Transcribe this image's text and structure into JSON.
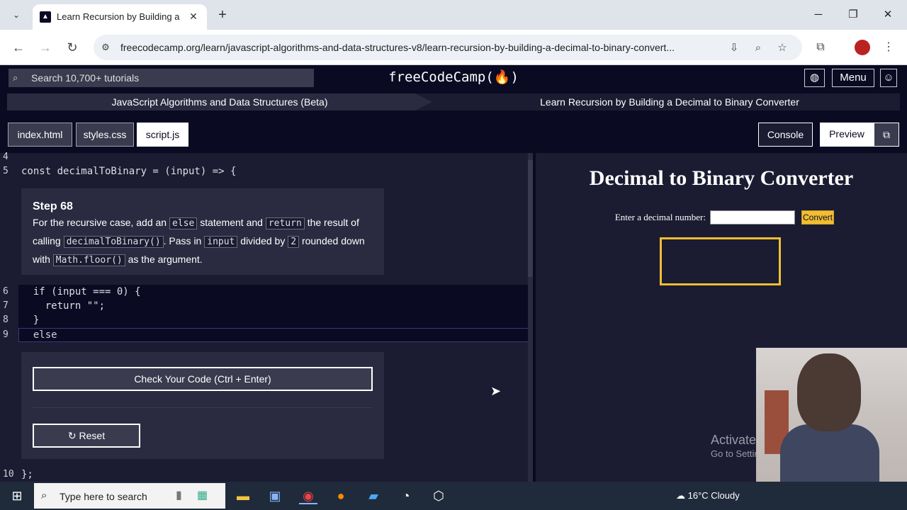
{
  "browser": {
    "tab_title": "Learn Recursion by Building a Decimal to Binary Converter",
    "url": "freecodecamp.org/learn/javascript-algorithms-and-data-structures-v8/learn-recursion-by-building-a-decimal-to-binary-convert..."
  },
  "fcc": {
    "search_placeholder": "Search 10,700+ tutorials",
    "logo": "freeCodeCamp(🔥)",
    "menu_label": "Menu"
  },
  "breadcrumb": {
    "course": "JavaScript Algorithms and Data Structures (Beta)",
    "project": "Learn Recursion by Building a Decimal to Binary Converter"
  },
  "file_tabs": [
    "index.html",
    "styles.css",
    "script.js"
  ],
  "right_tabs": {
    "console": "Console",
    "preview": "Preview"
  },
  "editor": {
    "line4_num": "4",
    "line5_num": "5",
    "line5_code": "const decimalToBinary = (input) => {",
    "lines": [
      {
        "num": "6",
        "code": "  if (input === 0) {"
      },
      {
        "num": "7",
        "code": "    return \"\";"
      },
      {
        "num": "8",
        "code": "  }"
      },
      {
        "num": "9",
        "code": "  else"
      }
    ],
    "line10_num": "10",
    "line10_code": "};"
  },
  "step": {
    "title": "Step 68",
    "t1": "For the recursive case, add an",
    "c1": "else",
    "t2": "statement and",
    "c2": "return",
    "t3": "the result of calling",
    "c3": "decimalToBinary()",
    "t4": ". Pass in",
    "c4": "input",
    "t5": "divided by",
    "c5": "2",
    "t6": "rounded down with",
    "c6": "Math.floor()",
    "t7": "as the argument."
  },
  "actions": {
    "check_label": "Check Your Code (Ctrl + Enter)",
    "reset_label": "Reset"
  },
  "preview": {
    "title": "Decimal to Binary Converter",
    "input_label": "Enter a decimal number:",
    "convert_label": "Convert"
  },
  "watermark": {
    "line1": "Activate",
    "line2": "Go to Settings"
  },
  "taskbar": {
    "search_placeholder": "Type here to search",
    "weather": "16°C  Cloudy"
  }
}
